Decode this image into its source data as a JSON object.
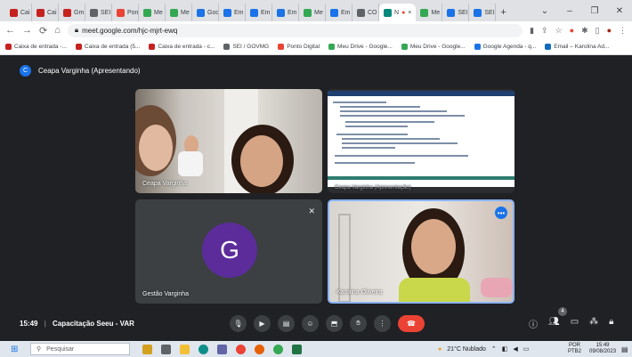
{
  "browser": {
    "tabs": [
      {
        "label": "Cai",
        "color": "#c5221f"
      },
      {
        "label": "Cai",
        "color": "#c5221f"
      },
      {
        "label": "Gm",
        "color": "#c5221f"
      },
      {
        "label": "SEI",
        "color": "#5f6368"
      },
      {
        "label": "Pon",
        "color": "#ea4335"
      },
      {
        "label": "Me",
        "color": "#34a853"
      },
      {
        "label": "Me",
        "color": "#34a853"
      },
      {
        "label": "Goc",
        "color": "#1a73e8"
      },
      {
        "label": "Em",
        "color": "#1a73e8"
      },
      {
        "label": "Em",
        "color": "#1a73e8"
      },
      {
        "label": "Em",
        "color": "#1a73e8"
      },
      {
        "label": "Me",
        "color": "#34a853"
      },
      {
        "label": "Em",
        "color": "#1a73e8"
      },
      {
        "label": "CO",
        "color": "#5f6368"
      },
      {
        "label": "N",
        "color": "#00897b",
        "active": true
      },
      {
        "label": "Me",
        "color": "#34a853"
      },
      {
        "label": "SEI",
        "color": "#1a73e8"
      },
      {
        "label": "SEI",
        "color": "#1a73e8"
      }
    ],
    "new_tab": "+",
    "url": "meet.google.com/hjc-mjrt-ewq",
    "bookmarks": [
      {
        "label": "Caixa de entrada -...",
        "icon": "gmail-icon"
      },
      {
        "label": "Caixa de entrada (5...",
        "icon": "gmail-icon"
      },
      {
        "label": "Caixa de entrada - c...",
        "icon": "gmail-icon"
      },
      {
        "label": "SEI / GOVMG",
        "icon": "sei-icon"
      },
      {
        "label": "Ponto Digital",
        "icon": "google-icon"
      },
      {
        "label": "Meu Drive - Google...",
        "icon": "drive-icon"
      },
      {
        "label": "Meu Drive - Google...",
        "icon": "drive-icon"
      },
      {
        "label": "Google Agenda - q...",
        "icon": "calendar-icon"
      },
      {
        "label": "Email – Karolina Ad...",
        "icon": "outlook-icon"
      }
    ]
  },
  "meet": {
    "presenter_initial": "C",
    "presenter_title": "Ceapa Varginha (Apresentando)",
    "tiles": {
      "tile1_name": "Ceapa Varginha",
      "tile2_caption": "Ceapa Varginha (Apresentação)",
      "tile3_name": "Gestão Varginha",
      "tile3_initial": "G",
      "tile4_name": "Karolina Oliveira"
    },
    "time": "15:49",
    "separator": "|",
    "meeting_name": "Capacitação Seeu - VAR",
    "participant_count": "4"
  },
  "taskbar": {
    "search_placeholder": "Pesquisar",
    "weather": "21°C  Nublado",
    "lang_top": "POR",
    "lang_bottom": "PTB2",
    "clock_time": "15:49",
    "clock_date": "09/08/2023"
  }
}
